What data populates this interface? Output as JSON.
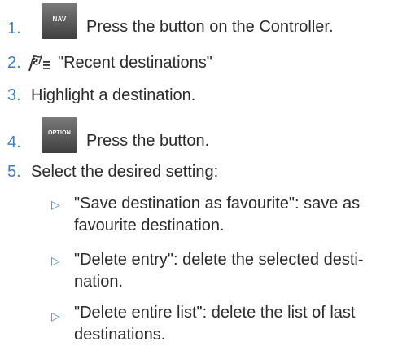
{
  "steps": [
    {
      "num": "1.",
      "key": "NAV",
      "text": "Press the button on the Controller."
    },
    {
      "num": "2.",
      "icon": "navigation-flag-menu-icon",
      "text": "\"Recent destinations\""
    },
    {
      "num": "3.",
      "text": "Highlight a destination."
    },
    {
      "num": "4.",
      "key": "OPTION",
      "text": "Press the button."
    },
    {
      "num": "5.",
      "text": "Select the desired setting:"
    }
  ],
  "options": [
    {
      "bullet": "▷",
      "text": "\"Save destination as favourite\": save as favourite destination."
    },
    {
      "bullet": "▷",
      "text": "\"Delete entry\": delete the selected desti-nation."
    },
    {
      "bullet": "▷",
      "text": "\"Delete entire list\": delete the list of last destinations."
    }
  ],
  "colors": {
    "number": "#3e7fc1",
    "text": "#2b2b2b",
    "key_bg": "#555555"
  }
}
